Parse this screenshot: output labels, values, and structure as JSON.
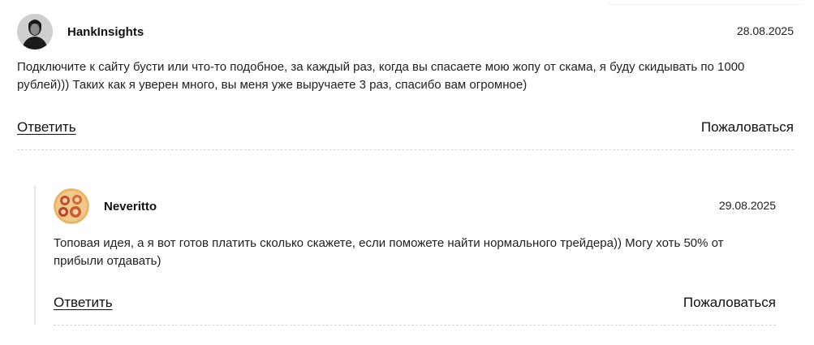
{
  "comments": [
    {
      "author": "HankInsights",
      "date": "28.08.2025",
      "text": "Подключите к сайту бусти или что-то подобное, за каждый раз, когда вы спасаете мою жопу от скама, я буду скидывать по 1000 рублей))) Таких как я уверен много, вы меня уже выручаете 3 раз, спасибо вам огромное)",
      "reply_label": "Ответить",
      "report_label": "Пожаловаться"
    },
    {
      "author": "Neveritto",
      "date": "29.08.2025",
      "text": "Топовая идея, а я вот готов платить сколько скажете, если поможете найти нормального трейдера)) Могу хоть 50% от прибыли отдавать)",
      "reply_label": "Ответить",
      "report_label": "Пожаловаться"
    }
  ]
}
